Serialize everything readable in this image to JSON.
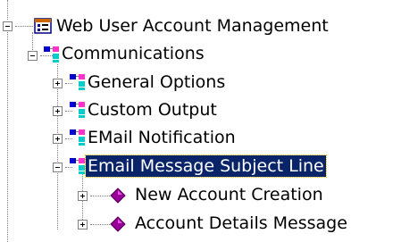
{
  "tree": {
    "root": {
      "label": "Web User Account Management",
      "icon": "app-window-icon",
      "expanded": true
    },
    "communications": {
      "label": "Communications",
      "icon": "tree-node-icon",
      "expanded": true
    },
    "general_options": {
      "label": "General Options",
      "icon": "tree-node-icon",
      "expanded": false
    },
    "custom_output": {
      "label": "Custom Output",
      "icon": "tree-node-icon",
      "expanded": false
    },
    "email_notification": {
      "label": "EMail Notification",
      "icon": "tree-node-icon",
      "expanded": false
    },
    "email_subject": {
      "label": "Email Message Subject Line",
      "icon": "tree-node-icon",
      "expanded": true,
      "selected": true
    },
    "new_account": {
      "label": "New Account Creation",
      "icon": "purple-diamond-icon",
      "expanded": false
    },
    "account_details": {
      "label": "Account Details Message",
      "icon": "purple-diamond-icon",
      "expanded": false
    }
  },
  "colors": {
    "selection": "#0a246a",
    "diamond": "#990099",
    "node_blue": "#0000cc",
    "node_pink": "#ff33cc",
    "node_cyan": "#00cccc"
  }
}
